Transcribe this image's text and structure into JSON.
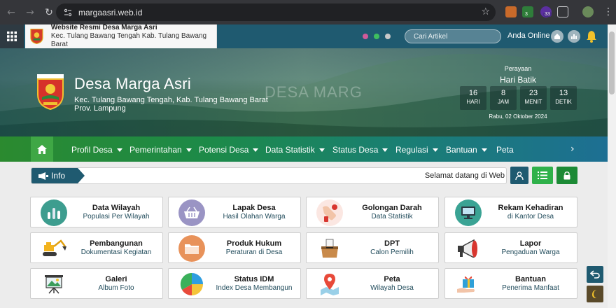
{
  "browser": {
    "url": "margaasri.web.id",
    "ext_badge_1": "3",
    "ext_badge_2": "33"
  },
  "topbar": {
    "site_title": "Website Resmi Desa Marga Asri",
    "site_subtitle": "Kec. Tulang Bawang Tengah Kab. Tulang Bawang Barat",
    "search_placeholder": "Cari Artikel",
    "online_label": "Anda Online",
    "dot_colors": [
      "#d05a9a",
      "#3fbf5f",
      "#c9c9c9"
    ]
  },
  "hero": {
    "title": "Desa Marga Asri",
    "subtitle_line1": "Kec. Tulang Bawang Tengah, Kab. Tulang Bawang Barat",
    "subtitle_line2": "Prov. Lampung",
    "watermark": "DESA MARG",
    "event_label": "Perayaan",
    "event_name": "Hari Batik",
    "countdown": [
      {
        "value": "16",
        "label": "HARI"
      },
      {
        "value": "8",
        "label": "JAM"
      },
      {
        "value": "23",
        "label": "MENIT"
      },
      {
        "value": "13",
        "label": "DETIK"
      }
    ],
    "date": "Rabu, 02 Oktober 2024"
  },
  "nav": {
    "items": [
      {
        "label": "Profil Desa",
        "dropdown": true
      },
      {
        "label": "Pemerintahan",
        "dropdown": true
      },
      {
        "label": "Potensi Desa",
        "dropdown": true
      },
      {
        "label": "Data Statistik",
        "dropdown": true
      },
      {
        "label": "Status Desa",
        "dropdown": true
      },
      {
        "label": "Regulasi",
        "dropdown": true
      },
      {
        "label": "Bantuan",
        "dropdown": true
      },
      {
        "label": "Peta",
        "dropdown": false
      }
    ]
  },
  "info": {
    "tag": "Info",
    "marquee": "Selamat datang di Web"
  },
  "cards": [
    {
      "title": "Data Wilayah",
      "subtitle": "Populasi Per Wilayah",
      "icon": "bar-chart-icon",
      "color": "#3d9d8f"
    },
    {
      "title": "Lapak Desa",
      "subtitle": "Hasil Olahan Warga",
      "icon": "basket-icon",
      "color": "#9a94c4"
    },
    {
      "title": "Golongan Darah",
      "subtitle": "Data Statistik",
      "icon": "blood-hand-icon",
      "color": "#f3d3cc"
    },
    {
      "title": "Rekam Kehadiran",
      "subtitle": "di Kantor Desa",
      "icon": "monitor-icon",
      "color": "#3aa394"
    },
    {
      "title": "Pembangunan",
      "subtitle": "Dokumentasi Kegiatan",
      "icon": "excavator-icon",
      "color": "#ffffff"
    },
    {
      "title": "Produk Hukum",
      "subtitle": "Peraturan di Desa",
      "icon": "folder-icon",
      "color": "#e8925a"
    },
    {
      "title": "DPT",
      "subtitle": "Calon Pemilih",
      "icon": "ballot-box-icon",
      "color": "#ffffff"
    },
    {
      "title": "Lapor",
      "subtitle": "Pengaduan Warga",
      "icon": "megaphone-icon",
      "color": "#ffffff"
    },
    {
      "title": "Galeri",
      "subtitle": "Album Foto",
      "icon": "picture-board-icon",
      "color": "#ffffff"
    },
    {
      "title": "Status IDM",
      "subtitle": "Index Desa Membangun",
      "icon": "pie-chart-icon",
      "color": "#ffffff"
    },
    {
      "title": "Peta",
      "subtitle": "Wilayah Desa",
      "icon": "map-pin-icon",
      "color": "#ffffff"
    },
    {
      "title": "Bantuan",
      "subtitle": "Penerima Manfaat",
      "icon": "gift-icon",
      "color": "#ffffff"
    }
  ]
}
